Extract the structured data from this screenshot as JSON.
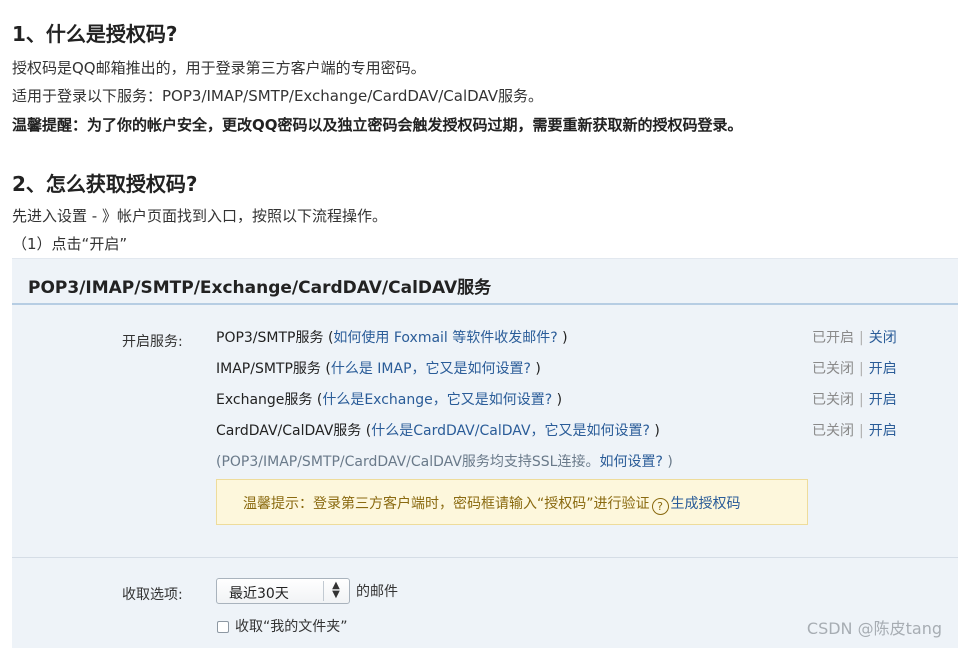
{
  "section1": {
    "heading": "1、什么是授权码?",
    "line1": "授权码是QQ邮箱推出的，用于登录第三方客户端的专用密码。",
    "line2": "适用于登录以下服务：POP3/IMAP/SMTP/Exchange/CardDAV/CalDAV服务。",
    "line3": "温馨提醒：为了你的帐户安全，更改QQ密码以及独立密码会触发授权码过期，需要重新获取新的授权码登录。"
  },
  "section2": {
    "heading": "2、怎么获取授权码?",
    "line1": "先进入设置 - 》帐户页面找到入口，按照以下流程操作。",
    "step1": "（1）点击“开启”"
  },
  "panel": {
    "title": "POP3/IMAP/SMTP/Exchange/CardDAV/CalDAV服务",
    "enable_label": "开启服务:",
    "services": [
      {
        "name": "POP3/SMTP服务 (",
        "link": "如何使用 Foxmail 等软件收发邮件?",
        "close": " )",
        "status": "已开启",
        "action": "关闭"
      },
      {
        "name": "IMAP/SMTP服务 (",
        "link": "什么是 IMAP，它又是如何设置?",
        "close": " )",
        "status": "已关闭",
        "action": "开启"
      },
      {
        "name": "Exchange服务 (",
        "link": "什么是Exchange，它又是如何设置?",
        "close": " )",
        "status": "已关闭",
        "action": "开启"
      },
      {
        "name": "CardDAV/CalDAV服务 (",
        "link": "什么是CardDAV/CalDAV，它又是如何设置?",
        "close": " )",
        "status": "已关闭",
        "action": "开启"
      }
    ],
    "ssl_note": "(POP3/IMAP/SMTP/CardDAV/CalDAV服务均支持SSL连接。",
    "ssl_link": "如何设置?",
    "ssl_close": " )",
    "separator": "|",
    "tip": {
      "text": "温馨提示：登录第三方客户端时，密码框请输入“授权码”进行验证",
      "help_icon": "?",
      "link": "生成授权码"
    },
    "receive_label": "收取选项:",
    "receive_select_value": "最近30天",
    "receive_suffix": "的邮件",
    "checkbox_label": "收取“我的文件夹”",
    "checkbox_checked": false
  },
  "watermark": "CSDN @陈皮tang"
}
